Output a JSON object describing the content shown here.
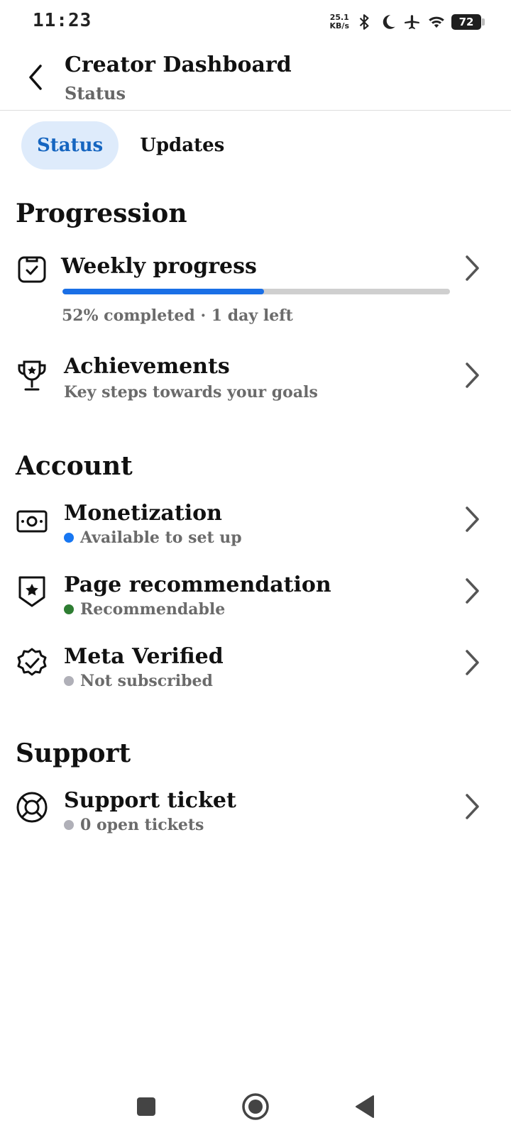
{
  "status_bar": {
    "time": "11:23",
    "speed_value": "25.1",
    "speed_unit": "KB/s",
    "battery": "72",
    "icons": [
      "bluetooth-icon",
      "moon-icon",
      "airplane-icon",
      "wifi-icon",
      "battery-icon"
    ]
  },
  "header": {
    "title": "Creator Dashboard",
    "subtitle": "Status"
  },
  "tabs": [
    {
      "label": "Status",
      "active": true
    },
    {
      "label": "Updates",
      "active": false
    }
  ],
  "progression": {
    "title": "Progression",
    "weekly": {
      "title": "Weekly progress",
      "progress_percent": 52,
      "caption": "52% completed · 1 day left"
    },
    "achievements": {
      "title": "Achievements",
      "subtitle": "Key steps towards your goals"
    }
  },
  "account": {
    "title": "Account",
    "items": [
      {
        "title": "Monetization",
        "status": "Available to set up",
        "dot_color": "#1877f2"
      },
      {
        "title": "Page recommendation",
        "status": "Recommendable",
        "dot_color": "#2e7d32"
      },
      {
        "title": "Meta Verified",
        "status": "Not subscribed",
        "dot_color": "#b0b0b8"
      }
    ]
  },
  "support": {
    "title": "Support",
    "items": [
      {
        "title": "Support ticket",
        "status": "0 open tickets",
        "dot_color": "#b0b0b8"
      }
    ]
  },
  "colors": {
    "accent": "#1565c0",
    "tab_active_bg": "#deebfb",
    "progress_fill": "#1a6fe6",
    "progress_track": "#cfcfcf"
  }
}
